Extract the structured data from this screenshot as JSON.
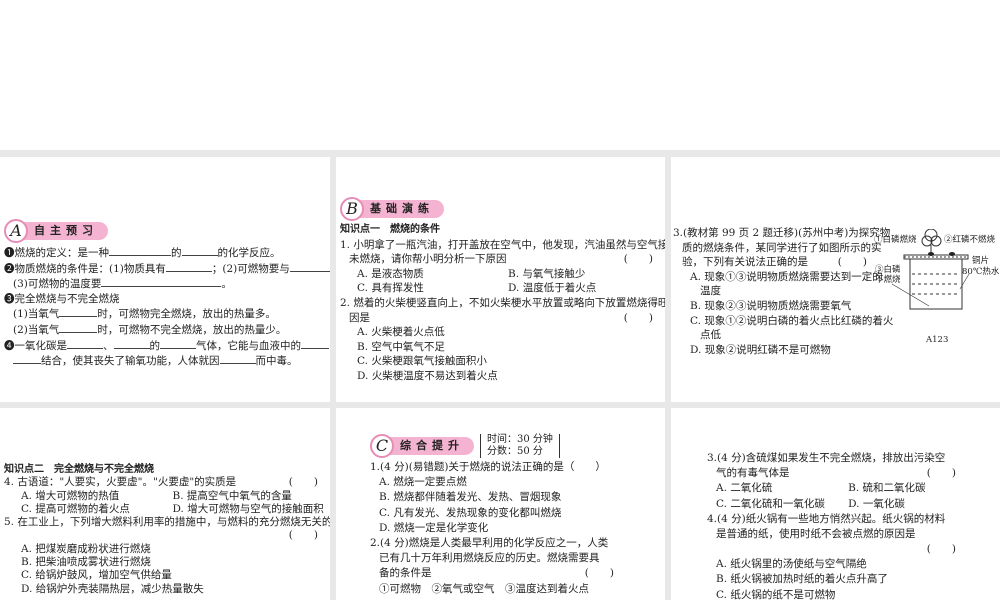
{
  "p1": {
    "badge_letter": "A",
    "badge": "自主预习",
    "l1": [
      "❶燃烧的定义：是一种",
      "的",
      "的化学反应。"
    ],
    "l2": [
      "❷物质燃烧的条件是：(1)物质具有",
      "；(2)可燃物要与",
      "；"
    ],
    "l3": [
      "(3)可燃物的温度要",
      "。"
    ],
    "l4": "❸完全燃烧与不完全燃烧",
    "l5": [
      "(1)当氧气",
      "时，可燃物完全燃烧，放出的热量多。"
    ],
    "l6": [
      "(2)当氧气",
      "时，可燃物不完全燃烧，放出的热量少。"
    ],
    "l7": [
      "❹一氧化碳是",
      "、",
      "的",
      "气体，它能与血液中的"
    ],
    "l8": [
      "结合，使其丧失了输氧功能，人体就因",
      "而中毒。"
    ]
  },
  "p2": {
    "badge_letter": "B",
    "badge": "基础演练",
    "kp": "知识点一　燃烧的条件",
    "q1": "1. 小明拿了一瓶汽油，打开盖放在空气中，他发现，汽油虽然与空气接触，但并",
    "q1b": "未燃烧，请你帮小明分析一下原因",
    "q1o": [
      "A. 是液态物质",
      "B. 与氧气接触少",
      "C. 具有挥发性",
      "D. 温度低于着火点"
    ],
    "q2": "2. 燃着的火柴梗竖直向上，不如火柴梗水平放置或略向下放置燃烧得旺，其原",
    "q2b": "因是",
    "q2o": [
      "A. 火柴梗着火点低",
      "B. 空气中氧气不足",
      "C. 火柴梗跟氧气接触面积小",
      "D. 火柴梗温度不易达到着火点"
    ],
    "paren": "(　　)"
  },
  "p3": {
    "q3": [
      "3.(教材第 99 页 2 题迁移)(苏州中考)为探究物",
      "质的燃烧条件，某同学进行了如图所示的实",
      "验，下列有关说法正确的是"
    ],
    "opts": [
      "A. 现象①③说明物质燃烧需要达到一定的",
      "温度",
      "B. 现象②③说明物质燃烧需要氧气",
      "C. 现象①②说明白磷的着火点比红磷的着火",
      "点低",
      "D. 现象②说明红磷不是可燃物"
    ],
    "fig": {
      "l1": "①白磷燃烧",
      "l2": "②红磷不燃烧",
      "l3": "铜片",
      "l4": "80℃热水",
      "l5a": "③白磷",
      "l5b": "不燃烧",
      "caption": "A123"
    }
  },
  "p4": {
    "kp": "知识点二　完全燃烧与不完全燃烧",
    "q4": "4. 古语道：\"人要实，火要虚\"。\"火要虚\"的实质是",
    "q4o": [
      "A. 增大可燃物的热值",
      "B. 提高空气中氧气的含量",
      "C. 提高可燃物的着火点",
      "D. 增大可燃物与空气的接触面积"
    ],
    "q5": "5. 在工业上，下列增大燃料利用率的措施中，与燃料的充分燃烧无关的是",
    "q5o": [
      "A. 把煤炭磨成粉状进行燃烧",
      "B. 把柴油喷成雾状进行燃烧",
      "C. 给锅炉鼓风，增加空气供给量",
      "D. 给锅炉外壳装隔热层，减少热量散失"
    ]
  },
  "p5": {
    "badge_letter": "C",
    "badge": "综合提升",
    "time": "时间：30 分钟",
    "score": "分数：50 分",
    "q1": "1.(4 分)(易错题)关于燃烧的说法正确的是（　　）",
    "q1o": [
      "A. 燃烧一定要点燃",
      "B. 燃烧都伴随着发光、发热、冒烟现象",
      "C. 凡有发光、发热现象的变化都叫燃烧",
      "D. 燃烧一定是化学变化"
    ],
    "q2": [
      "2.(4 分)燃烧是人类最早利用的化学反应之一，人类",
      "已有几十万年利用燃烧反应的历史。燃烧需要具",
      "备的条件是"
    ],
    "q2c": "①可燃物　②氧气或空气　③温度达到着火点"
  },
  "p6": {
    "q3": [
      "3.(4 分)含硫煤如果发生不完全燃烧，排放出污染空",
      "气的有毒气体是"
    ],
    "q3o": [
      "A. 二氧化硫",
      "B. 硫和二氧化碳",
      "C. 二氧化硫和一氧化碳",
      "D. 一氧化碳"
    ],
    "q4": [
      "4.(4 分)纸火锅有一些地方悄然兴起。纸火锅的材料",
      "是普通的纸，使用时纸不会被点燃的原因是"
    ],
    "q4o": [
      "A. 纸火锅里的汤使纸与空气隔绝",
      "B. 纸火锅被加热时纸的着火点升高了",
      "C. 纸火锅的纸不是可燃物"
    ]
  }
}
